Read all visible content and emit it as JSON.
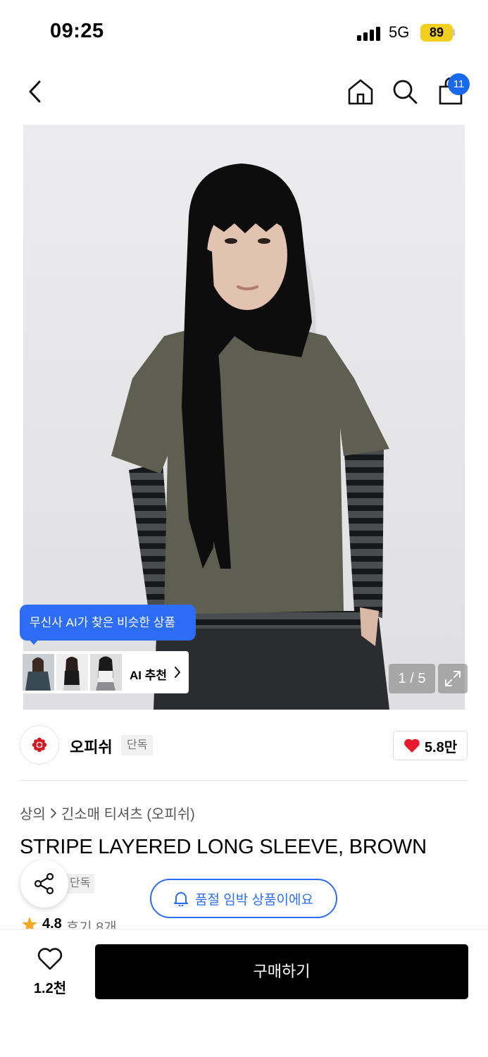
{
  "status_bar": {
    "time": "09:25",
    "network": "5G",
    "battery": "89"
  },
  "nav": {
    "back_icon": "chevron-left-icon",
    "home_icon": "home-icon",
    "search_icon": "search-icon",
    "cart_icon": "shopping-bag-icon",
    "cart_count": "11"
  },
  "gallery": {
    "ai_tooltip": "무신사 AI가 찾은 비슷한 상품",
    "ai_recommend_label": "AI 추천",
    "page_indicator": "1 / 5",
    "expand_icon": "expand-icon"
  },
  "brand": {
    "name": "오피쉬",
    "exclusive_tag": "단독",
    "like_count": "5.8만"
  },
  "breadcrumb": {
    "category": "상의",
    "subcategory": "긴소매 티셔츠 (오피쉬)"
  },
  "product": {
    "title": "STRIPE LAYERED LONG SLEEVE, BROWN",
    "exclusive_tag": "단독",
    "soldout_notice": "품절 임박 상품이에요",
    "rating": "4.8",
    "reviews": "후기 8개"
  },
  "bottom_bar": {
    "wish_count": "1.2천",
    "buy_label": "구매하기"
  },
  "colors": {
    "accent_blue": "#2d6df6",
    "badge_blue": "#1969ef",
    "battery_yellow": "#f2ce1f",
    "heart_red": "#e8192c",
    "star_orange": "#f5a623"
  }
}
